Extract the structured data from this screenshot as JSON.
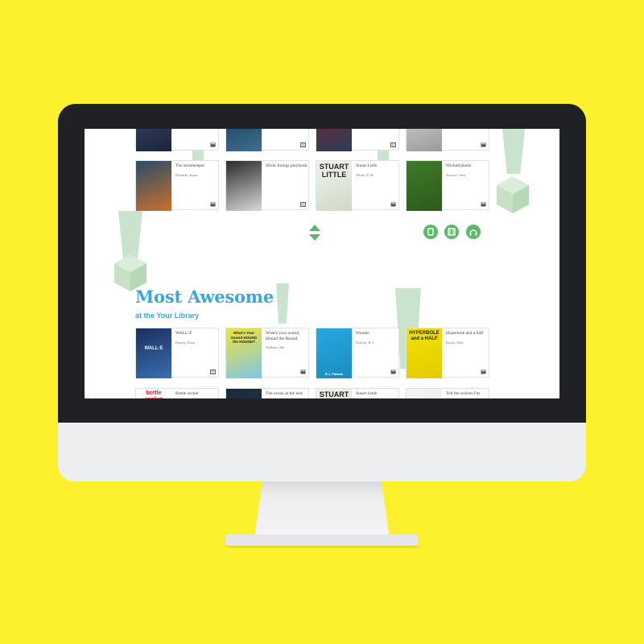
{
  "colors": {
    "background": "#fdf12e",
    "accent": "#3aa6df",
    "green": "#5cb86a",
    "bezel": "#1f2124"
  },
  "top_row": [
    {
      "title": "",
      "author": "",
      "media": "book-icon"
    },
    {
      "title": "",
      "author": "",
      "media": "film-icon"
    },
    {
      "title": "",
      "author": "",
      "media": "film-icon"
    },
    {
      "title": "",
      "author": "",
      "media": "book-icon"
    }
  ],
  "row2": [
    {
      "title": "The stonekeeper",
      "author": "Kibuishi, Kazu",
      "media": "book-icon",
      "cover_text": ""
    },
    {
      "title": "Silver linings playbook",
      "author": "",
      "media": "film-icon",
      "cover_text": ""
    },
    {
      "title": "Stuart Little",
      "author": "White, E. B.",
      "media": "book-icon",
      "cover_text": "STUART LITTLE"
    },
    {
      "title": "Wicked plants",
      "author": "Stewart, Amy",
      "media": "book-icon",
      "cover_text": ""
    }
  ],
  "media_filters": [
    "book-icon",
    "film-icon",
    "audio-icon"
  ],
  "section": {
    "title": "Most Awesome",
    "subtitle": "at the Your Library"
  },
  "row3": [
    {
      "title": "WALL-E",
      "author": "Disney–Pixar",
      "media": "film-icon",
      "cover_text": "WALL·E"
    },
    {
      "title": "What's your sound, Hound the Hound",
      "author": "Wilkens, Mo.",
      "media": "book-icon",
      "cover_text": "What's Your Sound HOUND the HOUND?"
    },
    {
      "title": "Wonder",
      "author": "Palacio, R. J.",
      "media": "book-icon",
      "cover_text": "R.J. Palacio"
    },
    {
      "title": "Hyperbole and a half",
      "author": "Brosh, Allie",
      "media": "book-icon",
      "cover_text": "HYPERBOLE and a HALF"
    }
  ],
  "row4": [
    {
      "title": "Bottle rocket",
      "cover_text": "bottle rocket"
    },
    {
      "title": "The ocean at the end",
      "cover_text": ""
    },
    {
      "title": "Stuart Little",
      "cover_text": "STUART LITTLE"
    },
    {
      "title": "Tell the wolves I'm",
      "cover_text": ""
    }
  ]
}
